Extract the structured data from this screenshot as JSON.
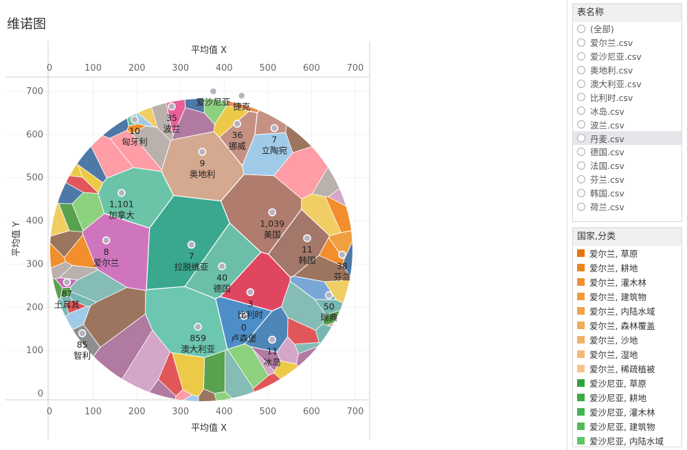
{
  "sheet": {
    "title": "维诺图"
  },
  "chart_data": {
    "type": "scatter",
    "title": "维诺图",
    "xlabel": "平均值 X",
    "ylabel": "平均值 Y",
    "xlim": [
      0,
      700
    ],
    "ylim": [
      0,
      700
    ],
    "x_ticks": [
      "0",
      "100",
      "200",
      "300",
      "400",
      "500",
      "600",
      "700"
    ],
    "y_ticks": [
      "0",
      "100",
      "200",
      "300",
      "400",
      "500",
      "600",
      "700"
    ],
    "points": [
      {
        "name": "加拿大",
        "value": "1,101",
        "x": 165,
        "y": 465,
        "color": "#6bc3a8"
      },
      {
        "name": "美国",
        "value": "1,039",
        "x": 510,
        "y": 420,
        "color": "#b07c6e"
      },
      {
        "name": "澳大利亚",
        "value": "859",
        "x": 340,
        "y": 155,
        "color": "#6dc6b0"
      },
      {
        "name": "土耳其",
        "value": "87",
        "x": 40,
        "y": 258,
        "color": "#c46bb5"
      },
      {
        "name": "智利",
        "value": "85",
        "x": 75,
        "y": 140,
        "color": "#8f8f8f"
      },
      {
        "name": "瑞典",
        "value": "50",
        "x": 640,
        "y": 228,
        "color": "#7aa7d6"
      },
      {
        "name": "德国",
        "value": "40",
        "x": 395,
        "y": 295,
        "color": "#6bbfa8"
      },
      {
        "name": "芬兰",
        "value": "38",
        "x": 670,
        "y": 322,
        "color": "#f0a040"
      },
      {
        "name": "挪威",
        "value": "36",
        "x": 430,
        "y": 625,
        "color": "#c49183"
      },
      {
        "name": "波兰",
        "value": "35",
        "x": 280,
        "y": 665,
        "color": "#e8609a"
      },
      {
        "name": "韩国",
        "value": "11",
        "x": 590,
        "y": 360,
        "color": "#a3786a"
      },
      {
        "name": "冰岛",
        "value": "11",
        "x": 510,
        "y": 125,
        "color": "#4f86b8"
      },
      {
        "name": "匈牙利",
        "value": "10",
        "x": 195,
        "y": 635,
        "color": "#6fc0a0"
      },
      {
        "name": "奥地利",
        "value": "9",
        "x": 350,
        "y": 560,
        "color": "#d4a98f"
      },
      {
        "name": "爱尔兰",
        "value": "8",
        "x": 130,
        "y": 355,
        "color": "#cf75be"
      },
      {
        "name": "立陶宛",
        "value": "7",
        "x": 515,
        "y": 615,
        "color": "#c49183"
      },
      {
        "name": "拉脱维亚",
        "value": "7",
        "x": 325,
        "y": 345,
        "color": "#3aa88e"
      },
      {
        "name": "比利时",
        "value": "3",
        "x": 460,
        "y": 235,
        "color": "#e04660"
      },
      {
        "name": "卢森堡",
        "value": "0",
        "x": 445,
        "y": 180,
        "color": "#4d8ec9"
      },
      {
        "name": "爱沙尼亚",
        "value": "",
        "x": 375,
        "y": 700,
        "color": "#4caf50"
      },
      {
        "name": "捷克",
        "value": "",
        "x": 440,
        "y": 690,
        "color": "#e89050"
      }
    ]
  },
  "filter": {
    "title": "表名称",
    "items": [
      "(全部)",
      "爱尔兰.csv",
      "爱沙尼亚.csv",
      "奥地利.csv",
      "澳大利亚.csv",
      "比利时.csv",
      "冰岛.csv",
      "波兰.csv",
      "丹麦.csv",
      "德国.csv",
      "法国.csv",
      "芬兰.csv",
      "韩国.csv",
      "荷兰.csv"
    ],
    "selected_index": 8
  },
  "legend": {
    "title": "国家,分类",
    "items": [
      {
        "label": "爱尔兰, 草原",
        "color": "#e8740c"
      },
      {
        "label": "爱尔兰, 耕地",
        "color": "#ec8420"
      },
      {
        "label": "爱尔兰, 灌木林",
        "color": "#ef922f"
      },
      {
        "label": "爱尔兰, 建筑物",
        "color": "#f09a3c"
      },
      {
        "label": "爱尔兰, 内陆水域",
        "color": "#f1a24a"
      },
      {
        "label": "爱尔兰, 森林覆盖",
        "color": "#f2aa58"
      },
      {
        "label": "爱尔兰, 沙地",
        "color": "#f3b266"
      },
      {
        "label": "爱尔兰, 湿地",
        "color": "#f4ba74"
      },
      {
        "label": "爱尔兰, 稀疏植被",
        "color": "#f6c488"
      },
      {
        "label": "爱沙尼亚, 草原",
        "color": "#2ea33a"
      },
      {
        "label": "爱沙尼亚, 耕地",
        "color": "#3aac45"
      },
      {
        "label": "爱沙尼亚, 灌木林",
        "color": "#46b450"
      },
      {
        "label": "爱沙尼亚, 建筑物",
        "color": "#52bc5b"
      },
      {
        "label": "爱沙尼亚, 内陆水域",
        "color": "#5ec466"
      }
    ]
  }
}
